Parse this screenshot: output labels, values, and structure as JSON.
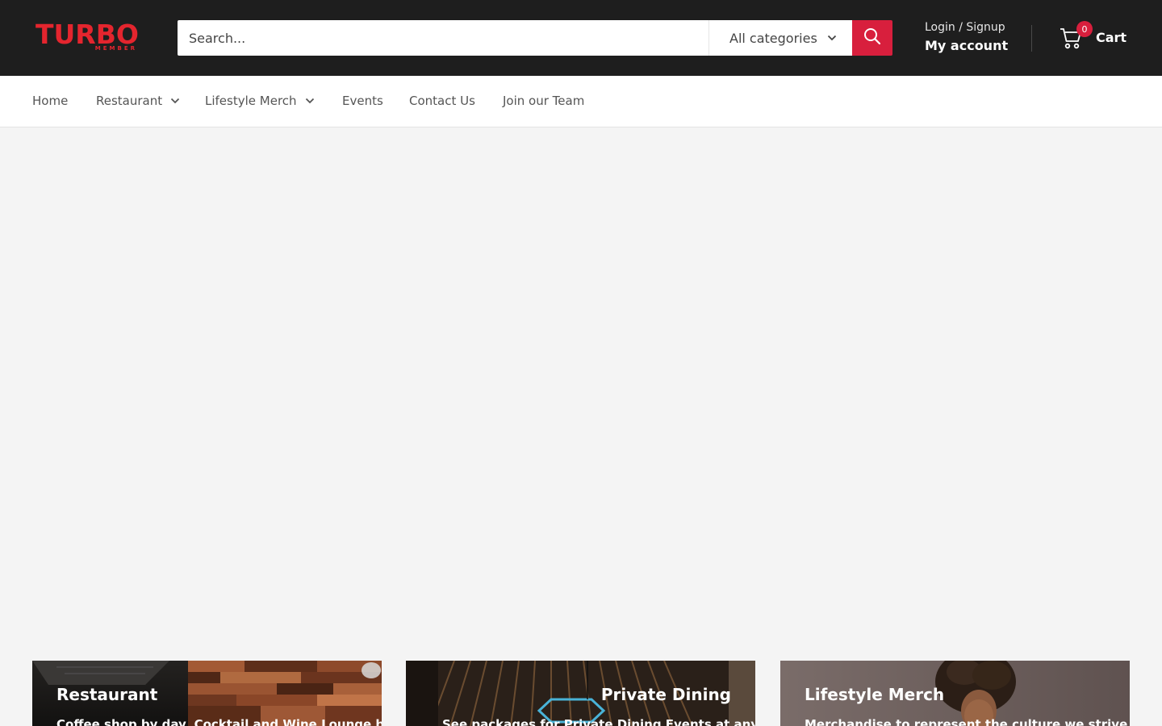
{
  "brand": {
    "logo_main": "TURBO",
    "logo_sub": "MEMBER"
  },
  "search": {
    "placeholder": "Search...",
    "category_label": "All categories"
  },
  "account": {
    "login_label": "Login / Signup",
    "my_account_label": "My account"
  },
  "cart": {
    "count": "0",
    "label": "Cart"
  },
  "nav": {
    "home": "Home",
    "restaurant": "Restaurant",
    "lifestyle_merch": "Lifestyle Merch",
    "events": "Events",
    "contact_us": "Contact Us",
    "join_our_team": "Join our Team"
  },
  "cards": [
    {
      "title": "Restaurant",
      "description": "Coffee shop by day, Cocktail and Wine Lounge by"
    },
    {
      "title": "Private Dining",
      "description": "See packages for Private Dining Events at any of"
    },
    {
      "title": "Lifestyle Merch",
      "description": "Merchandise to represent the culture we strive to"
    }
  ],
  "colors": {
    "header_bg": "#1e1e1e",
    "accent": "#d81f3d",
    "brand_red": "#e4252e",
    "page_bg": "#f4f4f4"
  }
}
